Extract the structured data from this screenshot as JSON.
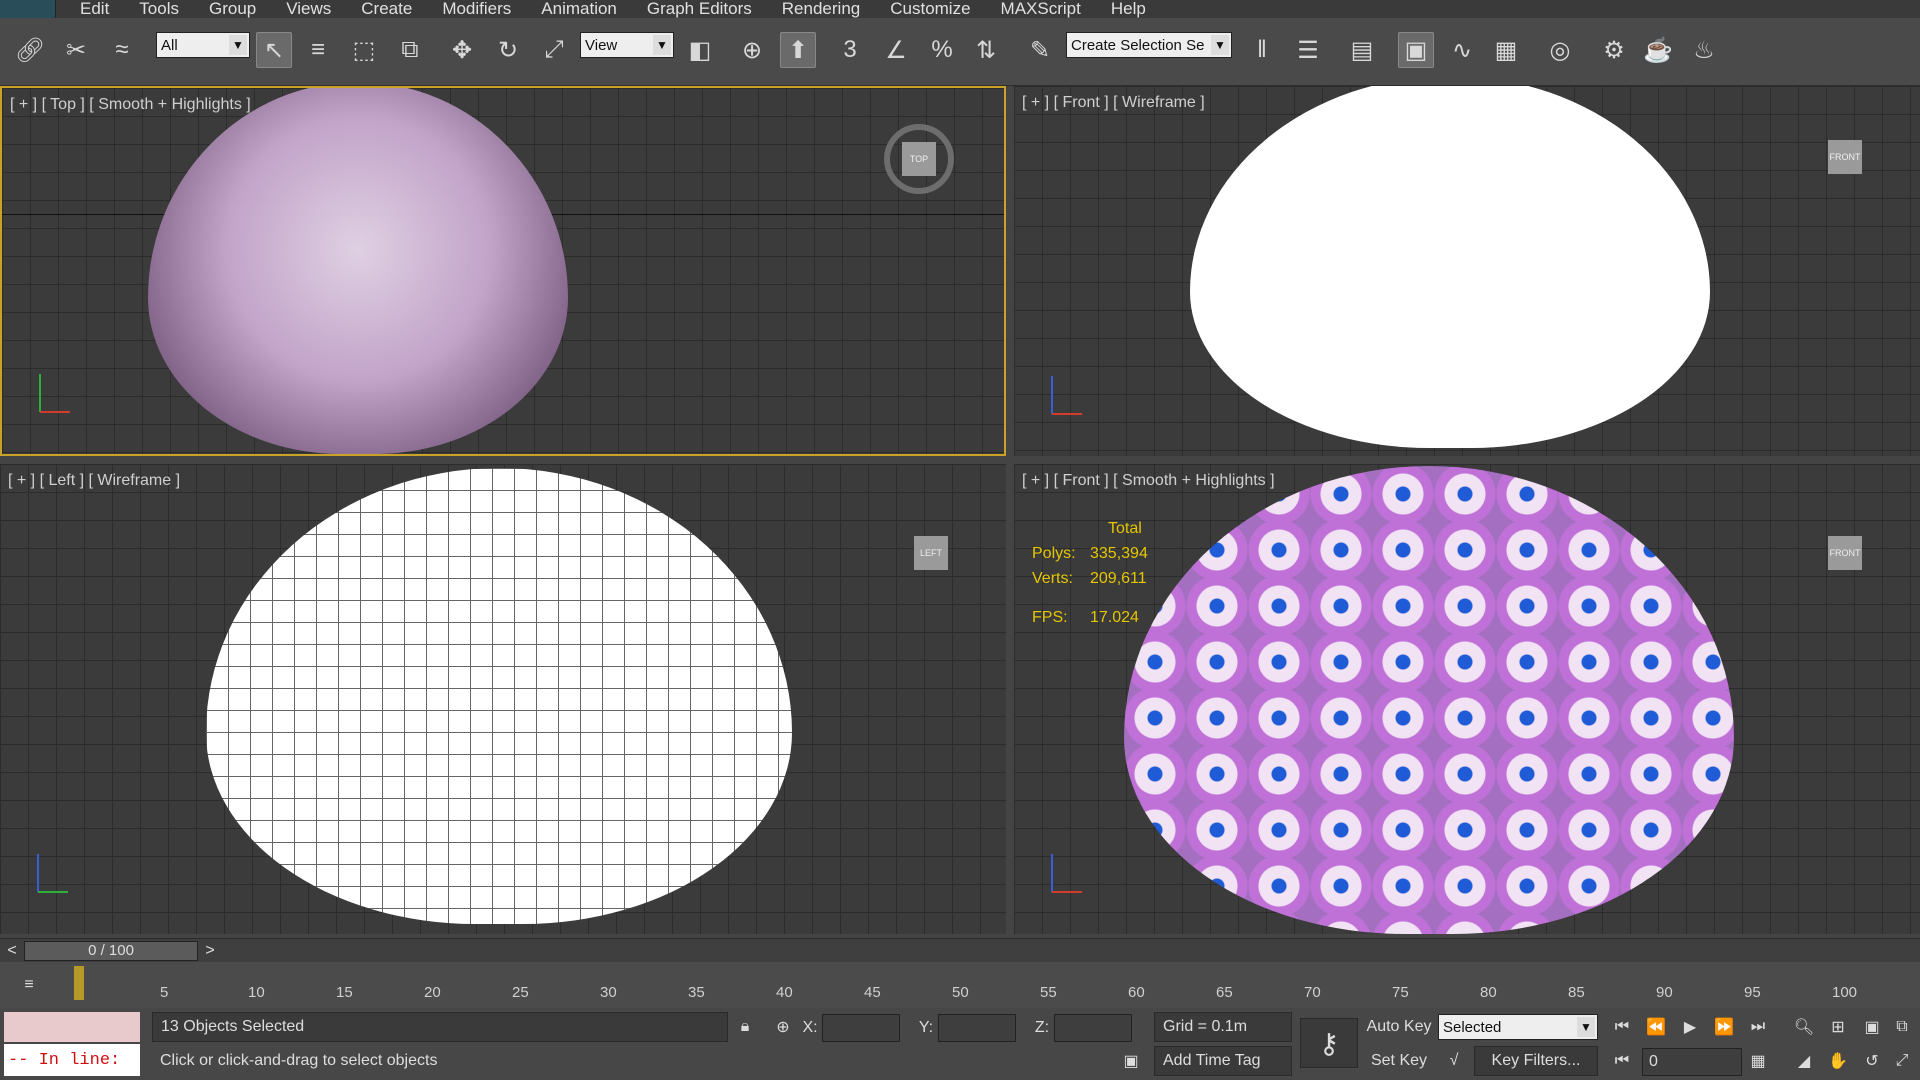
{
  "menu": [
    "Edit",
    "Tools",
    "Group",
    "Views",
    "Create",
    "Modifiers",
    "Animation",
    "Graph Editors",
    "Rendering",
    "Customize",
    "MAXScript",
    "Help"
  ],
  "toolbar": {
    "selection_filter": "All",
    "ref_coord": "View",
    "named_selection": "Create Selection Se",
    "snap_3": "3",
    "icons": [
      "link-icon",
      "unlink-icon",
      "bind-space-warp-icon",
      "select-object-icon",
      "select-by-name-icon",
      "rect-region-icon",
      "window-crossing-icon",
      "move-icon",
      "rotate-icon",
      "scale-icon",
      "pivot-icon",
      "manipulate-icon",
      "snaps-toggle-icon",
      "angle-snap-icon",
      "percent-snap-icon",
      "spinner-snap-icon",
      "edit-named-sel-icon",
      "mirror-icon",
      "align-icon",
      "layer-manager-icon",
      "scene-explorer-icon",
      "curve-editor-icon",
      "schematic-view-icon",
      "material-editor-icon",
      "render-setup-icon",
      "rendered-frame-icon",
      "render-icon"
    ]
  },
  "viewports": {
    "top_left": {
      "label": "[ + ] [ Top ] [ Smooth + Highlights ]",
      "cube": "TOP"
    },
    "top_right": {
      "label": "[ + ] [ Front ] [ Wireframe ]",
      "cube": "FRONT"
    },
    "bottom_left": {
      "label": "[ + ] [ Left ] [ Wireframe ]",
      "cube": "LEFT"
    },
    "bottom_right": {
      "label": "[ + ] [ Front ] [ Smooth + Highlights ]",
      "cube": "FRONT"
    }
  },
  "stats": {
    "header": "Total",
    "polys_label": "Polys:",
    "polys": "335,394",
    "verts_label": "Verts:",
    "verts": "209,611",
    "fps_label": "FPS:",
    "fps": "17.024"
  },
  "time": {
    "slider": "0 / 100",
    "ticks": [
      "5",
      "10",
      "15",
      "20",
      "25",
      "30",
      "35",
      "40",
      "45",
      "50",
      "55",
      "60",
      "65",
      "70",
      "75",
      "80",
      "85",
      "90",
      "95",
      "100"
    ]
  },
  "status": {
    "listener": "-- In line:",
    "selection": "13 Objects Selected",
    "prompt": "Click or click-and-drag to select objects",
    "x_label": "X:",
    "y_label": "Y:",
    "z_label": "Z:",
    "grid": "Grid = 0.1m",
    "add_time_tag": "Add Time Tag",
    "auto_key": "Auto Key",
    "set_key": "Set Key",
    "key_mode": "Selected",
    "key_filters": "Key Filters...",
    "frame": "0"
  }
}
